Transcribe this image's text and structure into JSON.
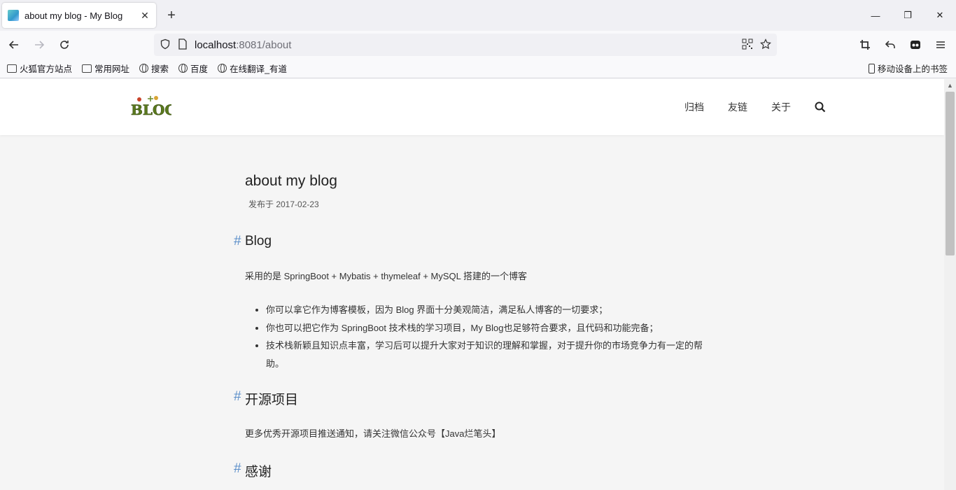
{
  "browser": {
    "tab_title": "about my blog - My Blog",
    "url_host": "localhost",
    "url_rest": ":8081/about",
    "bookmarks": [
      "火狐官方站点",
      "常用网址",
      "搜索",
      "百度",
      "在线翻译_有道"
    ],
    "mobile_bookmarks": "移动设备上的书签"
  },
  "site": {
    "logo_text": "BLOG",
    "nav": [
      "归档",
      "友链",
      "关于"
    ]
  },
  "post": {
    "title": "about my blog",
    "date": "发布于 2017-02-23",
    "sections": [
      {
        "heading": "Blog",
        "paragraph": "采用的是 SpringBoot + Mybatis + thymeleaf + MySQL 搭建的一个博客",
        "items": [
          "你可以拿它作为博客模板，因为 Blog 界面十分美观简洁，满足私人博客的一切要求；",
          "你也可以把它作为 SpringBoot 技术栈的学习项目，My Blog也足够符合要求，且代码和功能完备；",
          "技术栈新颖且知识点丰富，学习后可以提升大家对于知识的理解和掌握，对于提升你的市场竞争力有一定的帮助。"
        ]
      },
      {
        "heading": "开源项目",
        "paragraph": "更多优秀开源项目推送通知，请关注微信公众号【Java烂笔头】"
      },
      {
        "heading": "感谢"
      }
    ]
  }
}
